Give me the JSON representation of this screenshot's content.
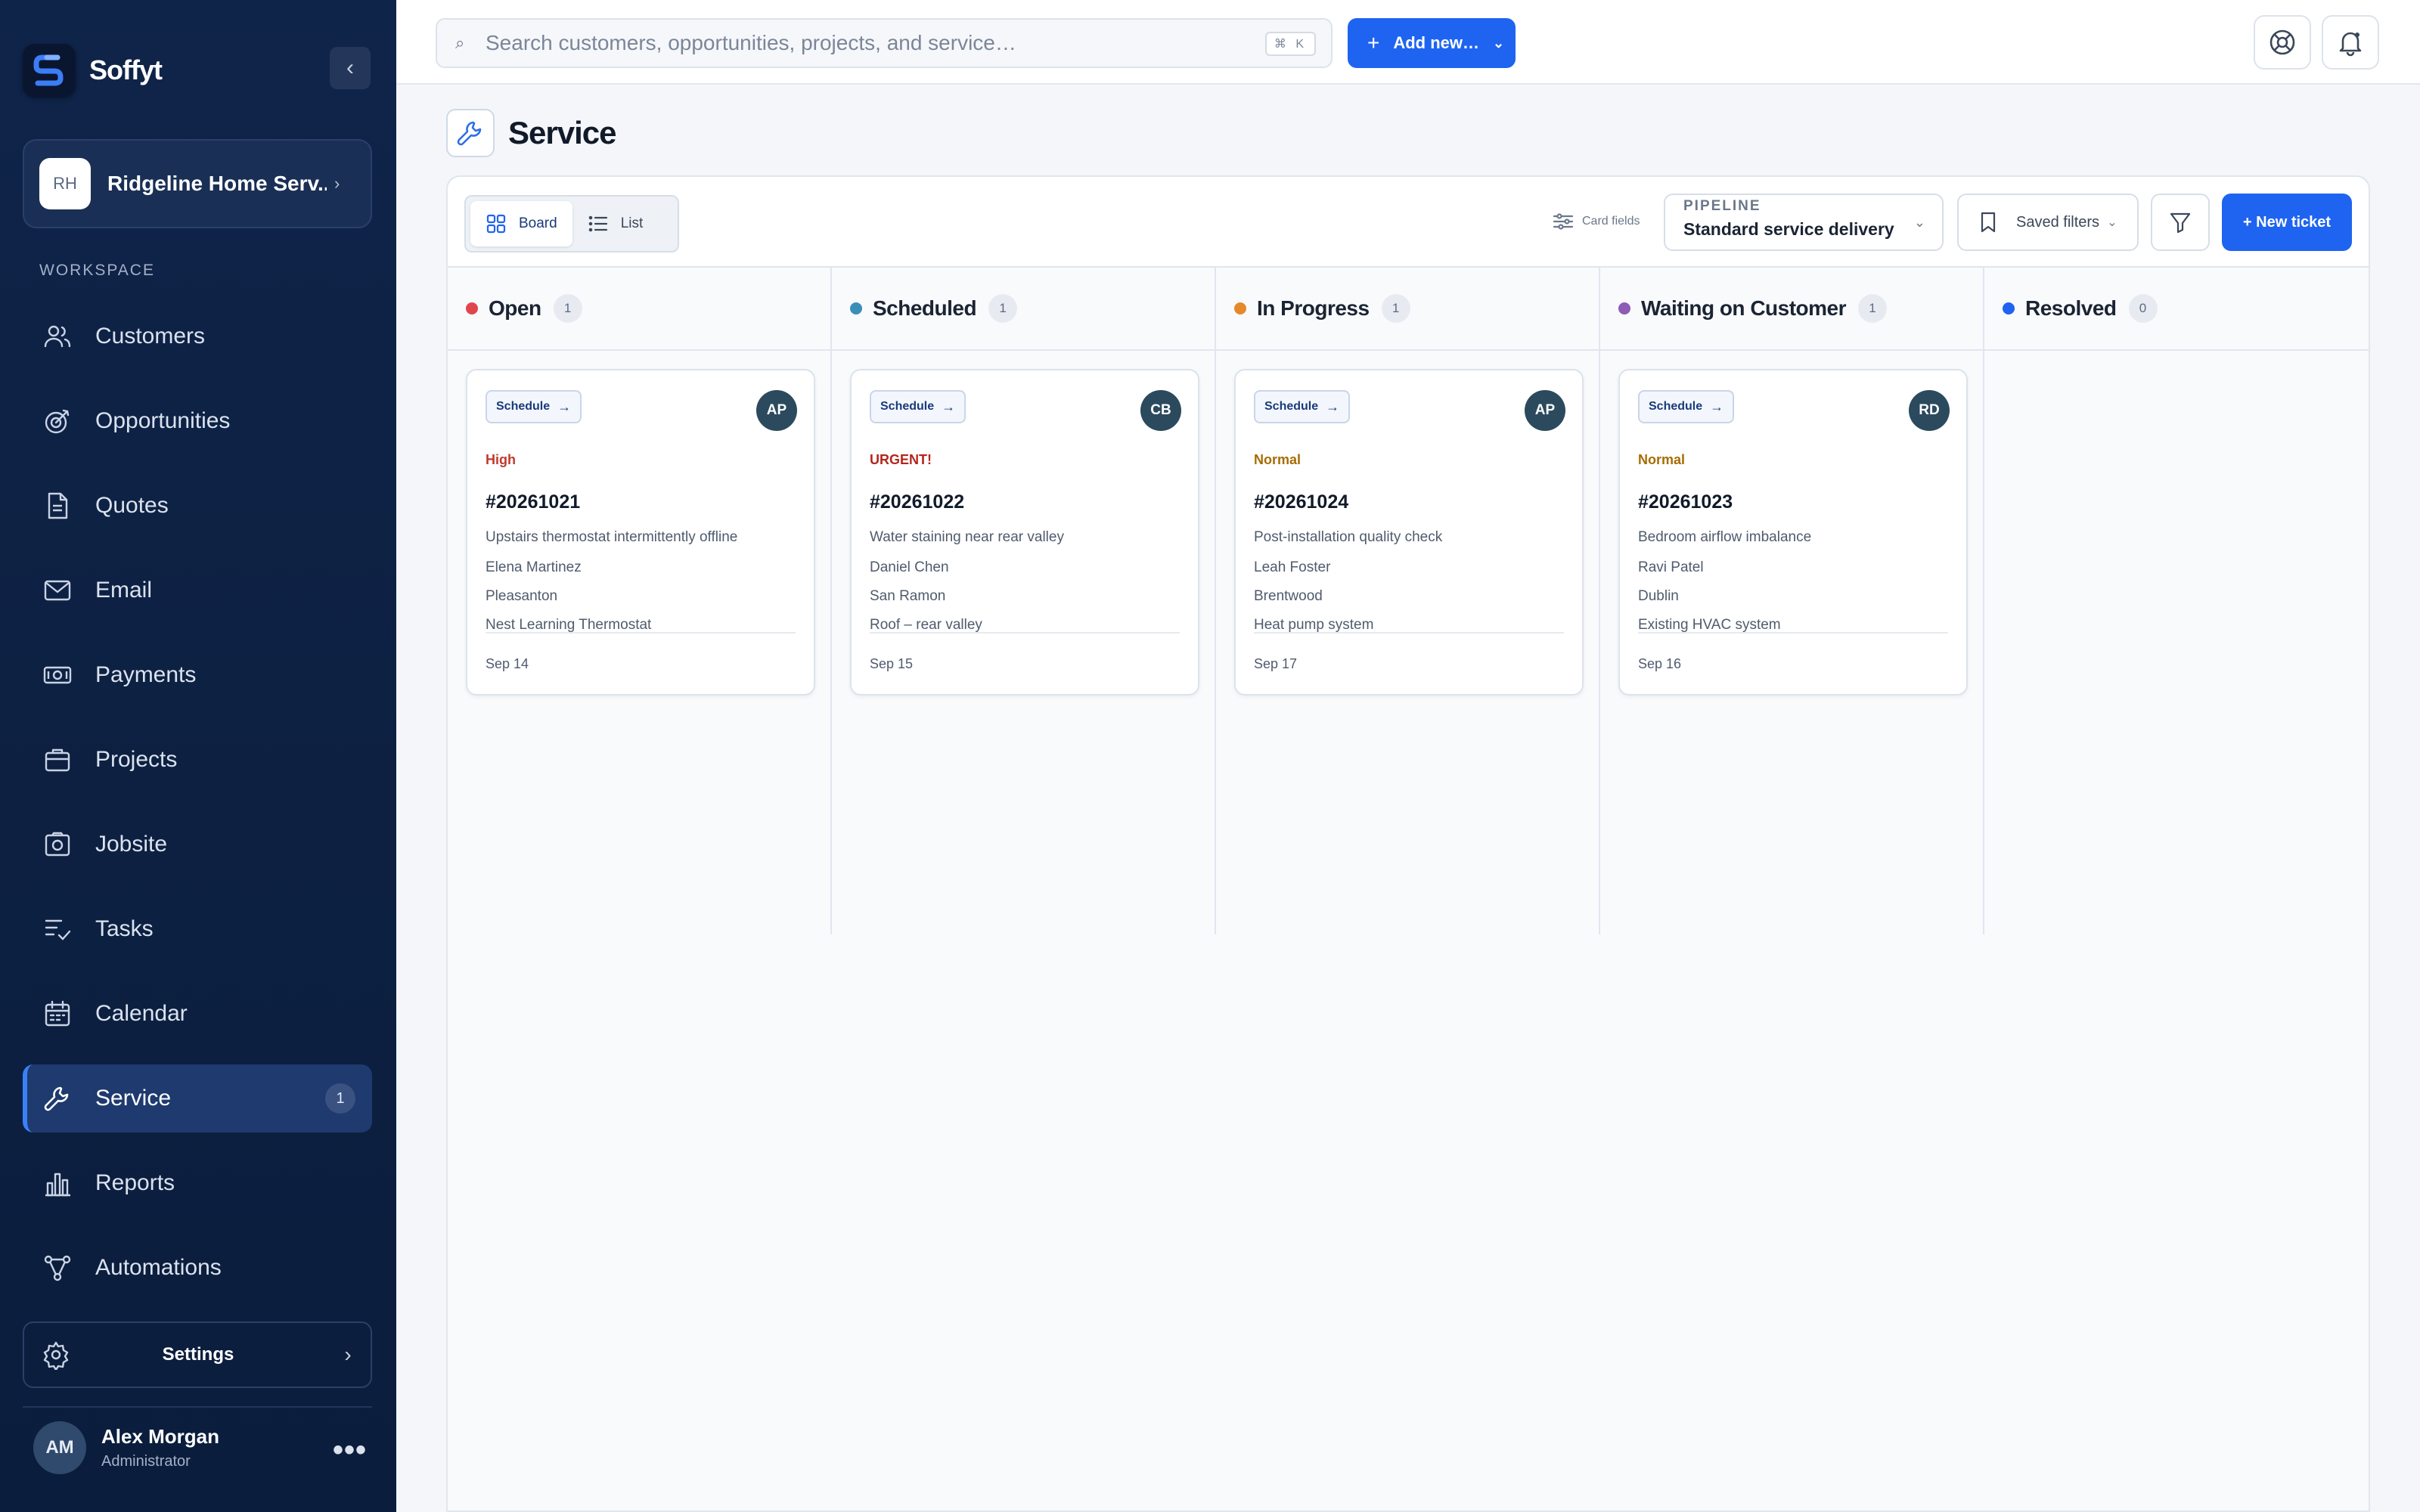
{
  "app": {
    "name": "Soffyt"
  },
  "org": {
    "initials": "RH",
    "name": "Ridgeline Home Serv...",
    "chevron": "›"
  },
  "sidebar": {
    "section_label": "WORKSPACE",
    "collapse_glyph": "‹",
    "items": [
      {
        "label": "Customers",
        "icon": "users-icon"
      },
      {
        "label": "Opportunities",
        "icon": "target-icon"
      },
      {
        "label": "Quotes",
        "icon": "document-icon"
      },
      {
        "label": "Email",
        "icon": "mail-icon"
      },
      {
        "label": "Payments",
        "icon": "payments-icon"
      },
      {
        "label": "Projects",
        "icon": "briefcase-icon"
      },
      {
        "label": "Jobsite",
        "icon": "camera-icon"
      },
      {
        "label": "Tasks",
        "icon": "tasks-icon"
      },
      {
        "label": "Calendar",
        "icon": "calendar-icon"
      },
      {
        "label": "Service",
        "icon": "wrench-icon",
        "active": true,
        "badge": "1"
      },
      {
        "label": "Reports",
        "icon": "bar-chart-icon"
      },
      {
        "label": "Automations",
        "icon": "workflow-icon"
      }
    ],
    "settings_label": "Settings",
    "settings_chevron": "›"
  },
  "user": {
    "initials": "AM",
    "name": "Alex Morgan",
    "role": "Administrator",
    "menu": "•••"
  },
  "topbar": {
    "search_placeholder": "Search customers, opportunities, projects, and service…",
    "search_icon": "⌕",
    "shortcut": "⌘ K",
    "add_new_plus": "+",
    "add_new_label": "Add new…",
    "add_new_chevron": "⌄"
  },
  "page": {
    "title": "Service"
  },
  "toolbar": {
    "board_label": "Board",
    "list_label": "List",
    "card_fields_label": "Card fields",
    "pipeline_label": "PIPELINE",
    "pipeline_value": "Standard service delivery",
    "pipeline_chevron": "⌄",
    "saved_filters_label": "Saved filters",
    "saved_chevron": "⌄",
    "new_ticket_label": "+ New ticket"
  },
  "columns": [
    {
      "title": "Open",
      "count": "1",
      "color": "#e0474c",
      "ticket": {
        "action": "Schedule",
        "arrow": "→",
        "assignee": "AP",
        "priority": "High",
        "priority_color": "#c0392b",
        "id": "#20261021",
        "summary": "Upstairs thermostat intermittently offline",
        "customer": "Elena Martinez",
        "city": "Pleasanton",
        "asset": "Nest Learning Thermostat",
        "date": "Sep 14"
      }
    },
    {
      "title": "Scheduled",
      "count": "1",
      "color": "#3a8fb7",
      "ticket": {
        "action": "Schedule",
        "arrow": "→",
        "assignee": "CB",
        "priority": "URGENT!",
        "priority_color": "#b3261e",
        "id": "#20261022",
        "summary": "Water staining near rear valley",
        "customer": "Daniel Chen",
        "city": "San Ramon",
        "asset": "Roof – rear valley",
        "date": "Sep 15"
      }
    },
    {
      "title": "In Progress",
      "count": "1",
      "color": "#e5892a",
      "ticket": {
        "action": "Schedule",
        "arrow": "→",
        "assignee": "AP",
        "priority": "Normal",
        "priority_color": "#a86b00",
        "id": "#20261024",
        "summary": "Post-installation quality check",
        "customer": "Leah Foster",
        "city": "Brentwood",
        "asset": "Heat pump system",
        "date": "Sep 17"
      }
    },
    {
      "title": "Waiting on Customer",
      "count": "1",
      "color": "#8e5bb5",
      "ticket": {
        "action": "Schedule",
        "arrow": "→",
        "assignee": "RD",
        "priority": "Normal",
        "priority_color": "#a86b00",
        "id": "#20261023",
        "summary": "Bedroom airflow imbalance",
        "customer": "Ravi Patel",
        "city": "Dublin",
        "asset": "Existing HVAC system",
        "date": "Sep 16"
      }
    },
    {
      "title": "Resolved",
      "count": "0",
      "color": "#1f64f0"
    }
  ]
}
